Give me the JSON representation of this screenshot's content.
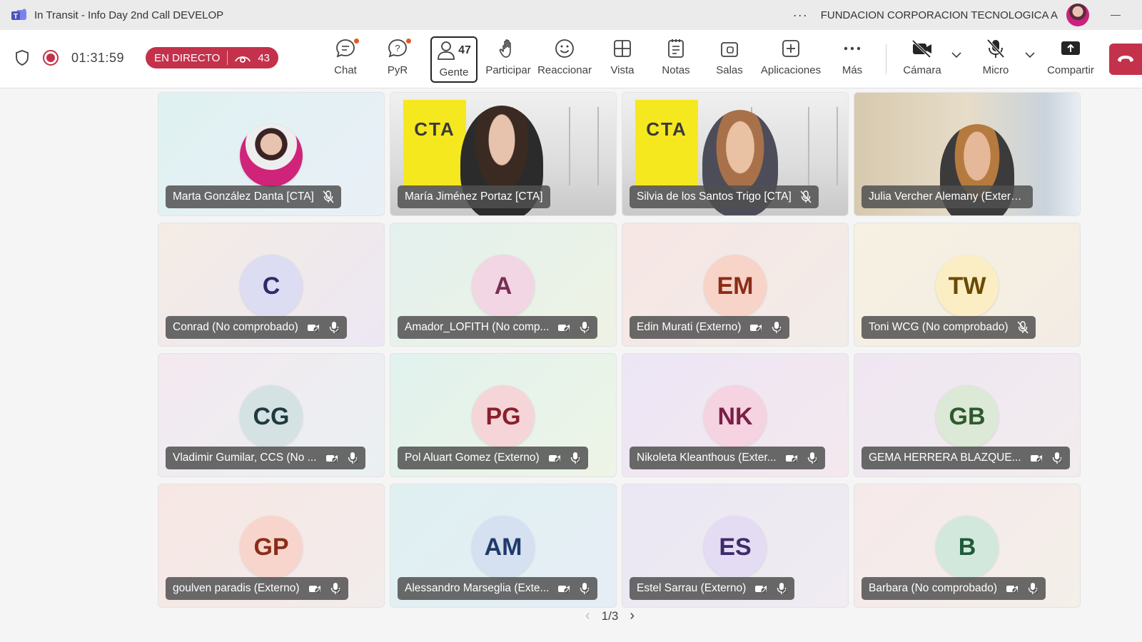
{
  "window": {
    "title": "In Transit - Info Day 2nd Call DEVELOP",
    "more_label": "···",
    "org": "FUNDACION CORPORACION TECNOLOGICA A"
  },
  "toolbar": {
    "timer": "01:31:59",
    "live_label": "EN DIRECTO",
    "viewer_count": "43",
    "people_count": "47",
    "buttons": {
      "chat": "Chat",
      "qa": "PyR",
      "people": "Gente",
      "raise": "Participar",
      "react": "Reaccionar",
      "view": "Vista",
      "notes": "Notas",
      "rooms": "Salas",
      "apps": "Aplicaciones",
      "more": "Más",
      "camera": "Cámara",
      "mic": "Micro",
      "share": "Compartir"
    }
  },
  "participants": [
    {
      "name": "Marta González Danta [CTA]",
      "type": "photo"
    },
    {
      "name": "María Jiménez Portaz [CTA]",
      "type": "video"
    },
    {
      "name": "Silvia de los Santos Trigo [CTA]",
      "type": "video"
    },
    {
      "name": "Julia Vercher Alemany (Externo)",
      "type": "video"
    },
    {
      "name": "Conrad (No comprobado)",
      "initials": "C",
      "color": "#2f2a6b",
      "bg": "#dcdcf2"
    },
    {
      "name": "Amador_LOFITH (No comp...",
      "initials": "A",
      "color": "#7a2e53",
      "bg": "#f3d6e3"
    },
    {
      "name": "Edin Murati (Externo)",
      "initials": "EM",
      "color": "#8a2d18",
      "bg": "#f7d3c8"
    },
    {
      "name": "Toni WCG (No comprobado)",
      "initials": "TW",
      "color": "#6b4a00",
      "bg": "#fbeec4"
    },
    {
      "name": "Vladimir Gumilar, CCS (No ...",
      "initials": "CG",
      "color": "#1f3a3f",
      "bg": "#d4e2e3"
    },
    {
      "name": "Pol Aluart Gomez (Externo)",
      "initials": "PG",
      "color": "#8a1f2c",
      "bg": "#f5d5d8"
    },
    {
      "name": "Nikoleta Kleanthous (Exter...",
      "initials": "NK",
      "color": "#7a1f45",
      "bg": "#f5d3e0"
    },
    {
      "name": "GEMA HERRERA BLAZQUE...",
      "initials": "GB",
      "color": "#2e5a2e",
      "bg": "#dbe9d6"
    },
    {
      "name": "goulven paradis (Externo)",
      "initials": "GP",
      "color": "#8a2d18",
      "bg": "#f7d5cc"
    },
    {
      "name": "Alessandro Marseglia (Exte...",
      "initials": "AM",
      "color": "#1f3a6b",
      "bg": "#d5e0f0"
    },
    {
      "name": "Estel Sarrau (Externo)",
      "initials": "ES",
      "color": "#3f2a6b",
      "bg": "#e3dcf2"
    },
    {
      "name": "Barbara (No comprobado)",
      "initials": "B",
      "color": "#1f5a3a",
      "bg": "#d3e8dc"
    }
  ],
  "pager": {
    "label": "1/3"
  },
  "cta_logo": "CTA"
}
